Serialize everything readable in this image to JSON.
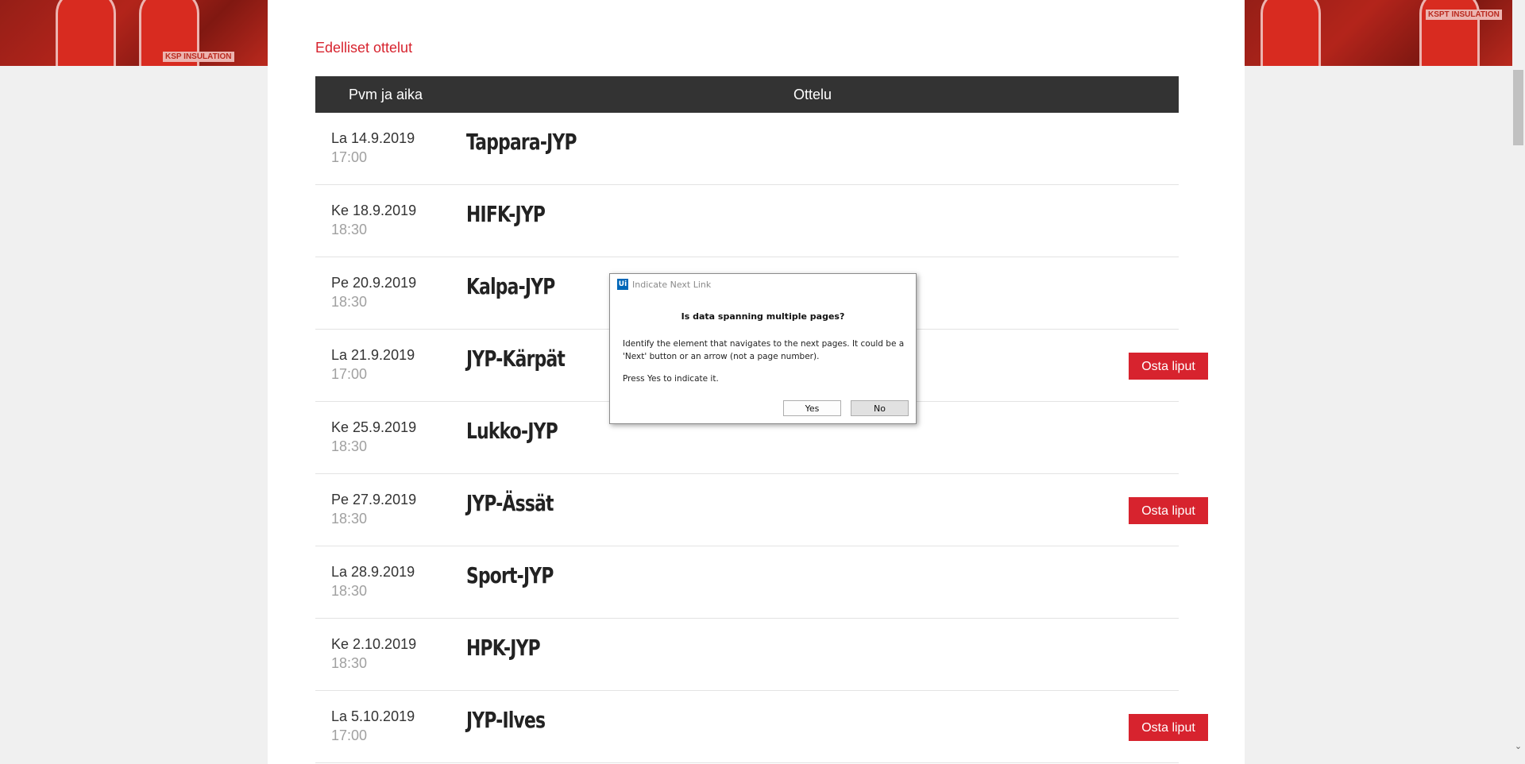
{
  "banner": {
    "left_patch": "KSP INSULATION",
    "right_patch": "KSPT INSULATION"
  },
  "section_title": "Edelliset ottelut",
  "table": {
    "headers": [
      "Pvm ja aika",
      "Ottelu"
    ],
    "rows": [
      {
        "date": "La 14.9.2019",
        "time": "17:00",
        "match": "Tappara-JYP",
        "button": ""
      },
      {
        "date": "Ke 18.9.2019",
        "time": "18:30",
        "match": "HIFK-JYP",
        "button": ""
      },
      {
        "date": "Pe 20.9.2019",
        "time": "18:30",
        "match": "Kalpa-JYP",
        "button": ""
      },
      {
        "date": "La 21.9.2019",
        "time": "17:00",
        "match": "JYP-Kärpät",
        "button": "Osta liput"
      },
      {
        "date": "Ke 25.9.2019",
        "time": "18:30",
        "match": "Lukko-JYP",
        "button": ""
      },
      {
        "date": "Pe 27.9.2019",
        "time": "18:30",
        "match": "JYP-Ässät",
        "button": "Osta liput"
      },
      {
        "date": "La 28.9.2019",
        "time": "18:30",
        "match": "Sport-JYP",
        "button": ""
      },
      {
        "date": "Ke 2.10.2019",
        "time": "18:30",
        "match": "HPK-JYP",
        "button": ""
      },
      {
        "date": "La 5.10.2019",
        "time": "17:00",
        "match": "JYP-Ilves",
        "button": "Osta liput"
      }
    ]
  },
  "dialog": {
    "icon_text": "Ui",
    "title": "Indicate Next Link",
    "heading": "Is data spanning multiple pages?",
    "message": "Identify the element that navigates to the next pages. It could be a 'Next' button or an arrow (not a page number).",
    "message2": "Press Yes to indicate it.",
    "yes_label": "Yes",
    "no_label": "No"
  },
  "scrollbar": {
    "down_glyph": "⌄"
  },
  "colors": {
    "accent": "#d7232e",
    "header_bg": "#333333",
    "dialog_icon": "#0067b8"
  }
}
